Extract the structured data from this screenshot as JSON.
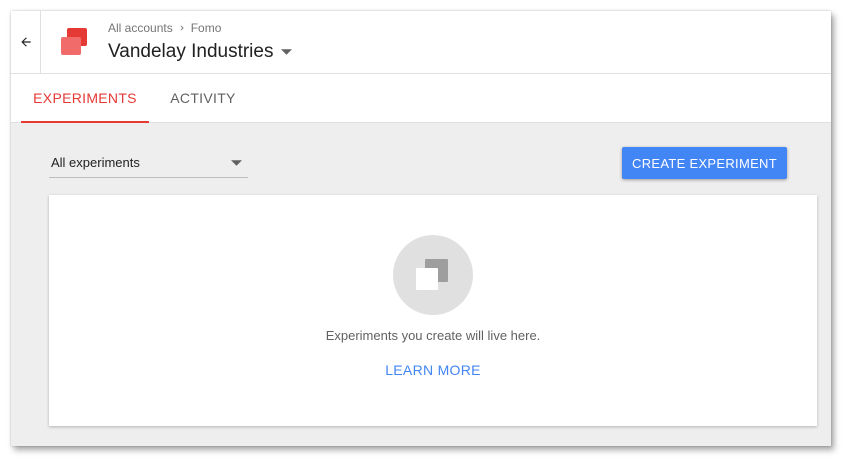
{
  "header": {
    "breadcrumb": [
      "All accounts",
      "Fomo"
    ],
    "account_name": "Vandelay Industries"
  },
  "tabs": [
    {
      "label": "EXPERIMENTS",
      "active": true
    },
    {
      "label": "ACTIVITY",
      "active": false
    }
  ],
  "filter": {
    "selected": "All experiments"
  },
  "toolbar": {
    "create_label": "CREATE EXPERIMENT"
  },
  "empty_state": {
    "message": "Experiments you create will live here.",
    "link_label": "LEARN MORE"
  },
  "icons": {
    "back": "arrow-left-icon",
    "logo": "optimize-logo",
    "breadcrumb_separator": "chevron-right-icon",
    "account_dropdown": "caret-down-icon",
    "filter_dropdown": "caret-down-icon",
    "empty_state": "experiment-squares-icon"
  },
  "colors": {
    "accent": "#e53935",
    "primary": "#4285f4",
    "logo_front": "#f26b6b",
    "logo_back": "#e53935"
  }
}
